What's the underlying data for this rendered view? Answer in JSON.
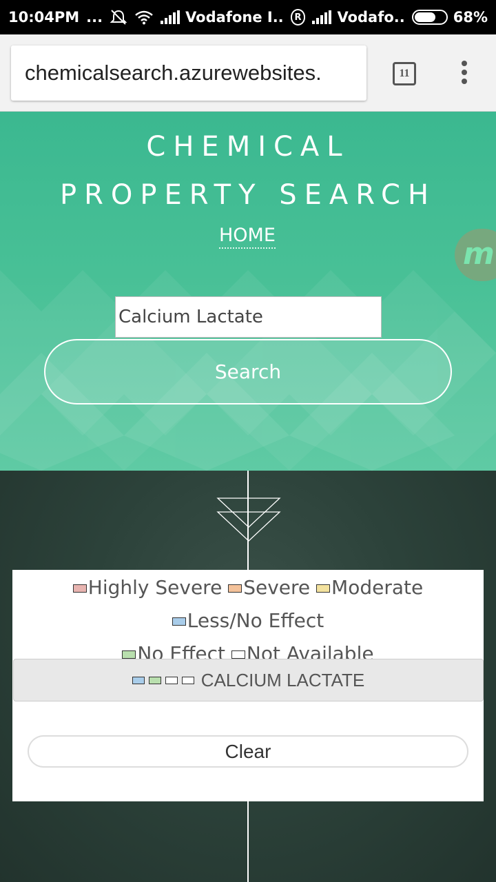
{
  "status_bar": {
    "time": "10:04PM",
    "dots": "...",
    "carrier1": "Vodafone I..",
    "roaming_mark": "R",
    "carrier2": "Vodafo..",
    "battery_percent": "68%",
    "battery_level": 0.68
  },
  "browser": {
    "url": "chemicalsearch.azurewebsites.",
    "tab_count": "11",
    "icons": [
      "tab-switcher-icon",
      "overflow-menu-icon"
    ]
  },
  "hero": {
    "title_line1": "CHEMICAL",
    "title_line2": "PROPERTY SEARCH",
    "home_link": "HOME",
    "badge_letter": "m",
    "search_value": "Calcium Lactate",
    "search_button": "Search"
  },
  "legend": {
    "items": [
      {
        "label": "Highly Severe",
        "color": "#e8b4b0"
      },
      {
        "label": "Severe",
        "color": "#f4c29a"
      },
      {
        "label": "Moderate",
        "color": "#f3e29e"
      },
      {
        "label": "Less/No Effect",
        "color": "#a9cdea"
      },
      {
        "label": "No Effect",
        "color": "#b9dfae"
      },
      {
        "label": "Not Available",
        "color": "#ffffff"
      }
    ]
  },
  "result": {
    "name": "CALCIUM LACTATE",
    "swatches": [
      "#a9cdea",
      "#b9dfae",
      "#ffffff",
      "#ffffff"
    ]
  },
  "clear_button": "Clear",
  "colors": {
    "hero_green": "#48c096",
    "dark_bg": "#2c423a"
  }
}
